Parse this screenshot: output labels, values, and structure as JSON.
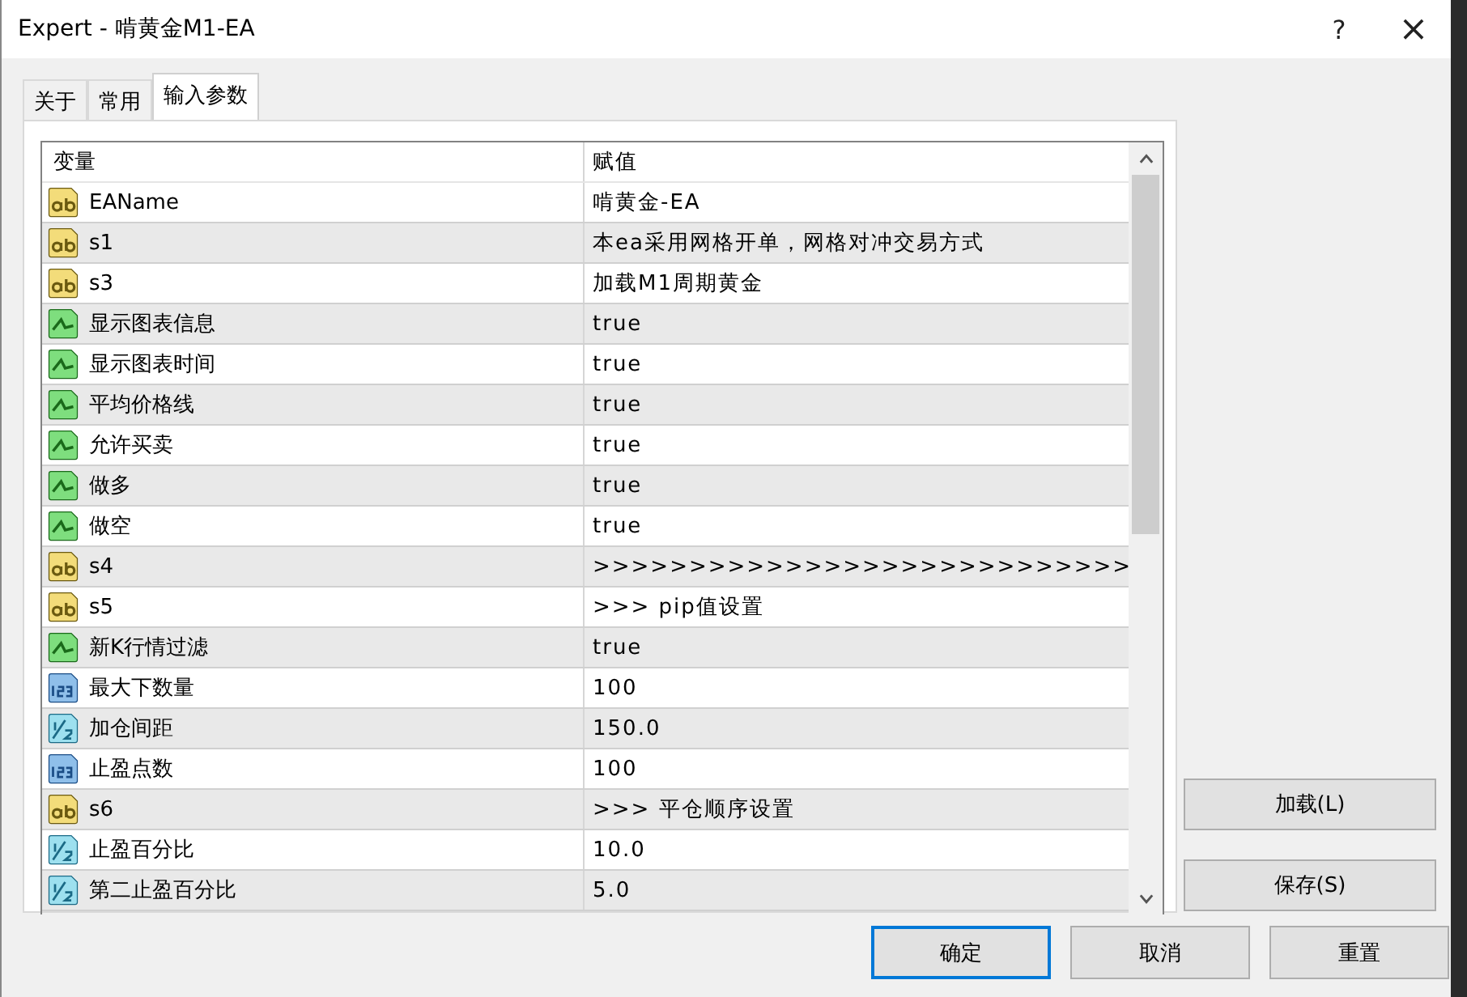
{
  "window": {
    "title": "Expert - 啃黄金M1-EA",
    "help": "?",
    "close": "×"
  },
  "tabs": [
    {
      "label": "关于",
      "selected": false
    },
    {
      "label": "常用",
      "selected": false
    },
    {
      "label": "输入参数",
      "selected": true
    }
  ],
  "table": {
    "columns": [
      "变量",
      "赋值"
    ],
    "rows": [
      {
        "kind": "string",
        "name": "EAName",
        "value": "啃黄金-EA"
      },
      {
        "kind": "string",
        "name": "s1",
        "value": "本ea采用网格开单，网格对冲交易方式"
      },
      {
        "kind": "string",
        "name": "s3",
        "value": "加载M1周期黄金"
      },
      {
        "kind": "bool",
        "name": "显示图表信息",
        "value": "true"
      },
      {
        "kind": "bool",
        "name": "显示图表时间",
        "value": "true"
      },
      {
        "kind": "bool",
        "name": "平均价格线",
        "value": "true"
      },
      {
        "kind": "bool",
        "name": "允许买卖",
        "value": "true"
      },
      {
        "kind": "bool",
        "name": "做多",
        "value": "true"
      },
      {
        "kind": "bool",
        "name": "做空",
        "value": "true"
      },
      {
        "kind": "string",
        "name": "s4",
        "value": ">>>>>>>>>>>>>>>>>>>>>>>>>>>>"
      },
      {
        "kind": "string",
        "name": "s5",
        "value": ">>> pip值设置"
      },
      {
        "kind": "bool",
        "name": "新K行情过滤",
        "value": "true"
      },
      {
        "kind": "int",
        "name": "最大下数量",
        "value": "100"
      },
      {
        "kind": "double",
        "name": "加仓间距",
        "value": "150.0"
      },
      {
        "kind": "int",
        "name": "止盈点数",
        "value": "100"
      },
      {
        "kind": "string",
        "name": "s6",
        "value": ">>> 平仓顺序设置"
      },
      {
        "kind": "double",
        "name": "止盈百分比",
        "value": "10.0"
      },
      {
        "kind": "double",
        "name": "第二止盈百分比",
        "value": "5.0"
      }
    ]
  },
  "side_buttons": [
    "加载(L)",
    "保存(S)"
  ],
  "buttons": [
    {
      "label": "确定",
      "selected": true
    },
    {
      "label": "取消",
      "selected": false
    },
    {
      "label": "重置",
      "selected": false
    }
  ]
}
